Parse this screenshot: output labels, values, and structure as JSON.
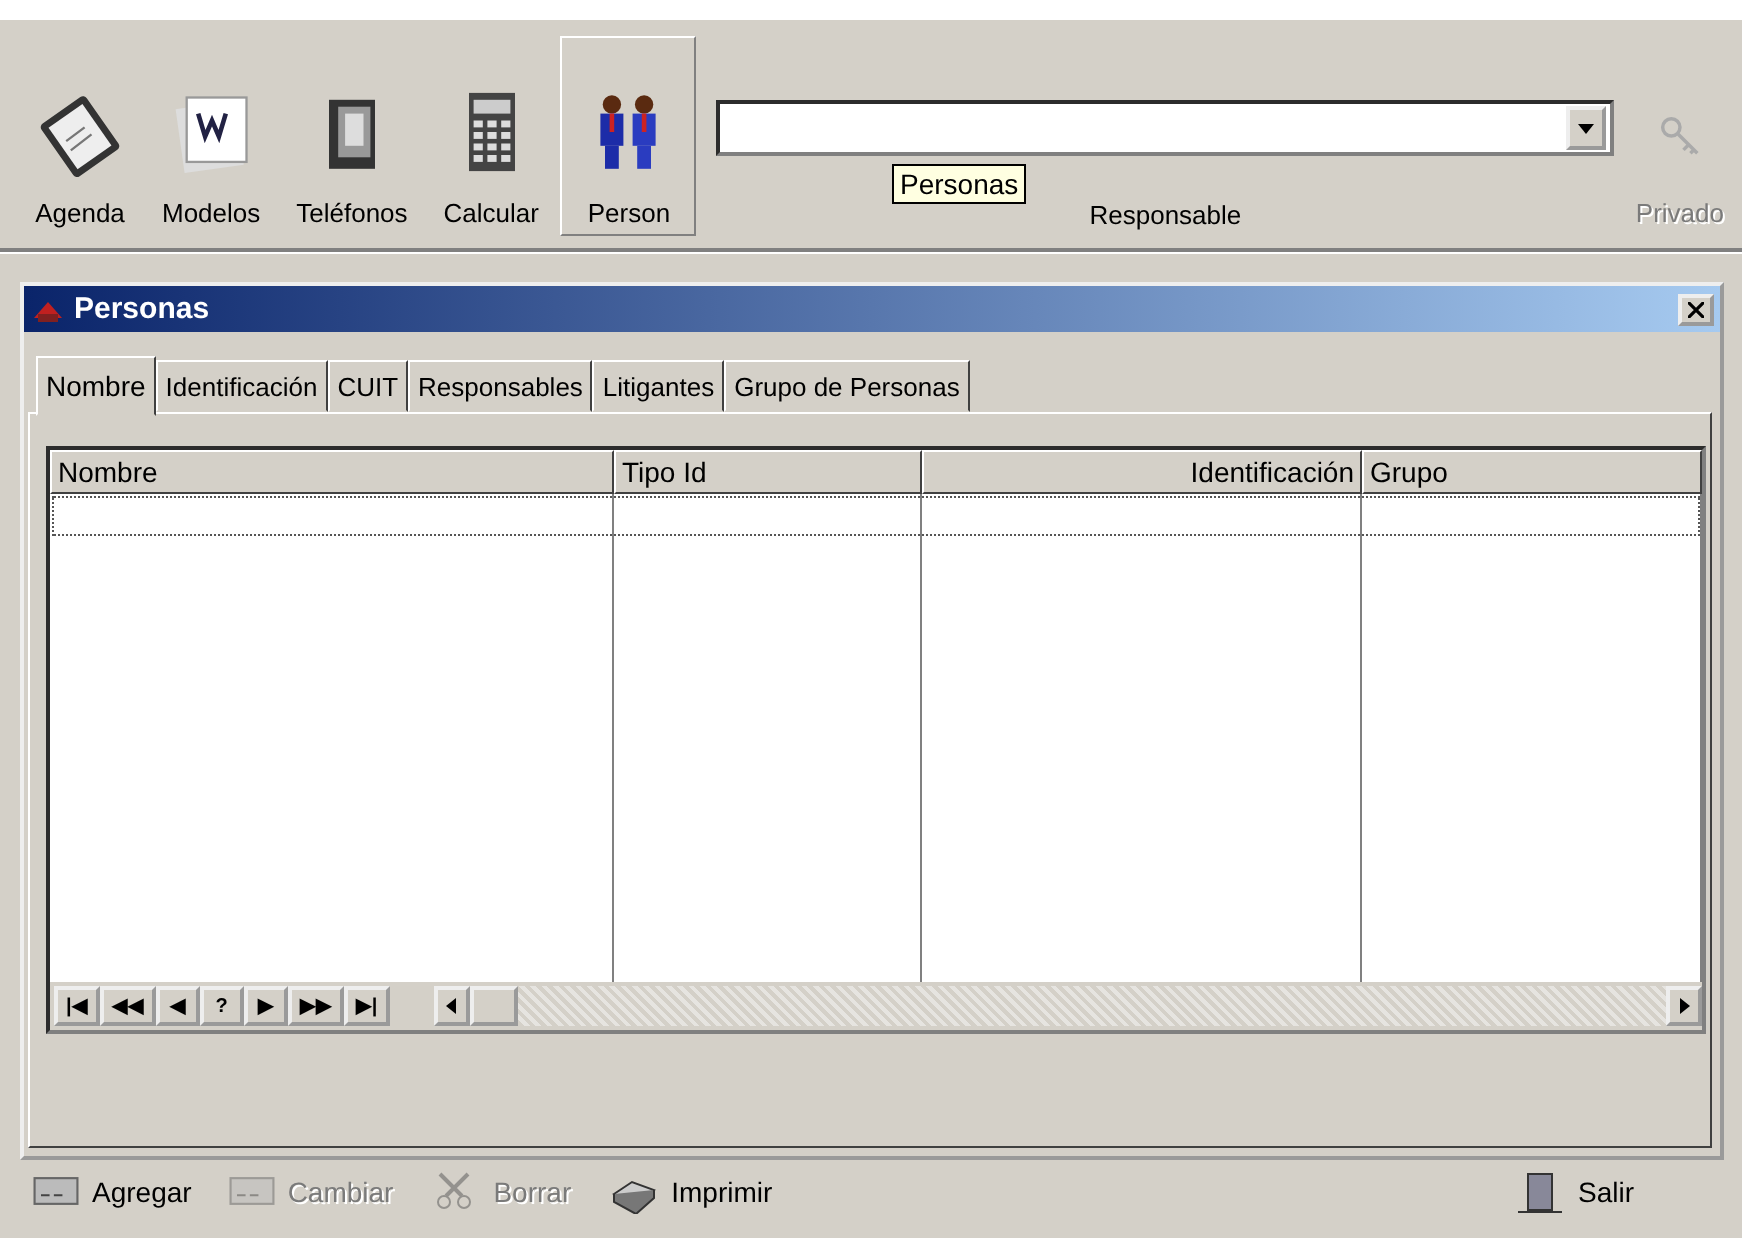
{
  "toolbar": {
    "items": [
      {
        "label": "Agenda",
        "kind": "agenda",
        "pressed": false,
        "disabled": false
      },
      {
        "label": "Modelos",
        "kind": "modelos",
        "pressed": false,
        "disabled": false
      },
      {
        "label": "Teléfonos",
        "kind": "telefonos",
        "pressed": false,
        "disabled": false
      },
      {
        "label": "Calcular",
        "kind": "calcular",
        "pressed": false,
        "disabled": false
      },
      {
        "label": "Person",
        "kind": "personas",
        "pressed": true,
        "disabled": false
      }
    ],
    "tooltip": "Personas",
    "responsable": {
      "label": "Responsable"
    },
    "privado": {
      "label": "Privado",
      "disabled": true
    }
  },
  "window": {
    "title": "Personas",
    "tabs": [
      {
        "label": "Nombre",
        "selected": true
      },
      {
        "label": "Identificación",
        "selected": false
      },
      {
        "label": "CUIT",
        "selected": false
      },
      {
        "label": "Responsables",
        "selected": false
      },
      {
        "label": "Litigantes",
        "selected": false
      },
      {
        "label": "Grupo de Personas",
        "selected": false
      }
    ],
    "table": {
      "columns": [
        {
          "label": "Nombre"
        },
        {
          "label": "Tipo Id"
        },
        {
          "label": "Identificación"
        },
        {
          "label": "Grupo"
        }
      ]
    },
    "navigator": [
      "|◀",
      "◀◀",
      "◀",
      "?",
      "▶",
      "▶▶",
      "▶|"
    ]
  },
  "buttons": [
    {
      "label": "Agregar",
      "kind": "agregar",
      "disabled": false
    },
    {
      "label": "Cambiar",
      "kind": "cambiar",
      "disabled": true
    },
    {
      "label": "Borrar",
      "kind": "borrar",
      "disabled": true
    },
    {
      "label": "Imprimir",
      "kind": "imprimir",
      "disabled": false
    },
    {
      "label": "Salir",
      "kind": "salir",
      "disabled": false
    }
  ]
}
